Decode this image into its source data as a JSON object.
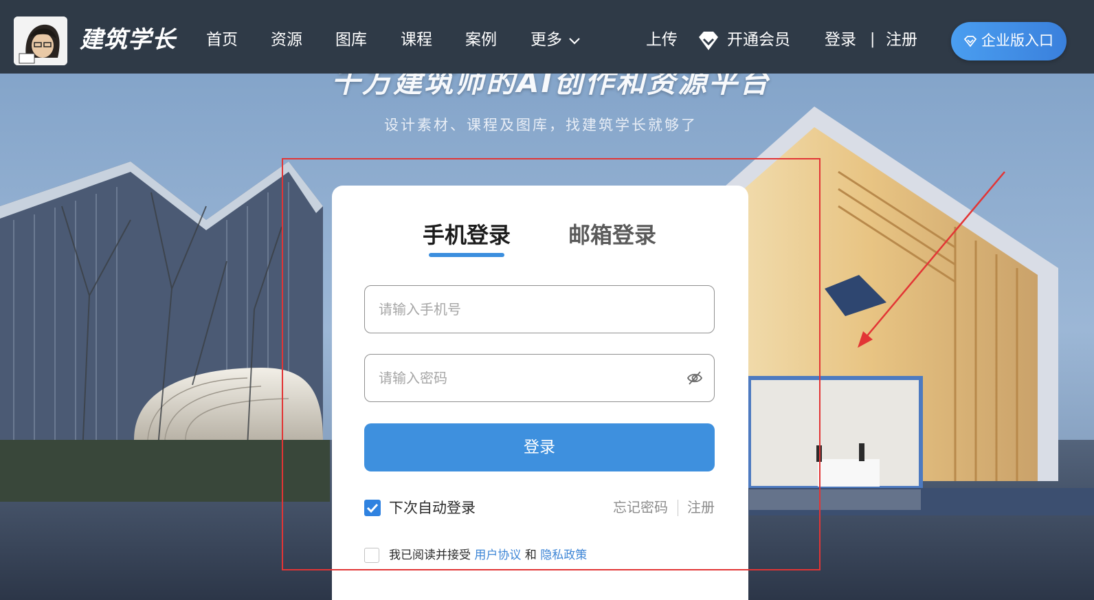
{
  "nav": {
    "logo_text": "建筑学长",
    "items": [
      "首页",
      "资源",
      "图库",
      "课程",
      "案例",
      "更多"
    ],
    "upload": "上传",
    "vip": "开通会员",
    "login": "登录",
    "divider": "|",
    "register": "注册",
    "enterprise": "企业版入口"
  },
  "hero": {
    "title": "千万建筑师的AI创作和资源平台",
    "subtitle": "设计素材、课程及图库，找建筑学长就够了"
  },
  "login": {
    "tabs": [
      "手机登录",
      "邮箱登录"
    ],
    "active_tab": "手机登录",
    "phone_placeholder": "请输入手机号",
    "password_placeholder": "请输入密码",
    "submit": "登录",
    "auto_login": "下次自动登录",
    "auto_login_checked": true,
    "forgot": "忘记密码",
    "register": "注册",
    "agree_prefix": "我已阅读并接受",
    "agree_user": "用户协议",
    "agree_and": "和",
    "agree_privacy": "隐私政策",
    "agree_checked": false
  },
  "icons": {
    "nav_more": "chevron-down-icon",
    "vip": "diamond-icon",
    "enterprise": "diamond-outline-icon",
    "password_toggle": "eye-off-icon",
    "checkbox": "check-icon"
  },
  "colors": {
    "nav_bg": "#2f3a47",
    "accent": "#3e90de",
    "annotation": "#e23535"
  }
}
